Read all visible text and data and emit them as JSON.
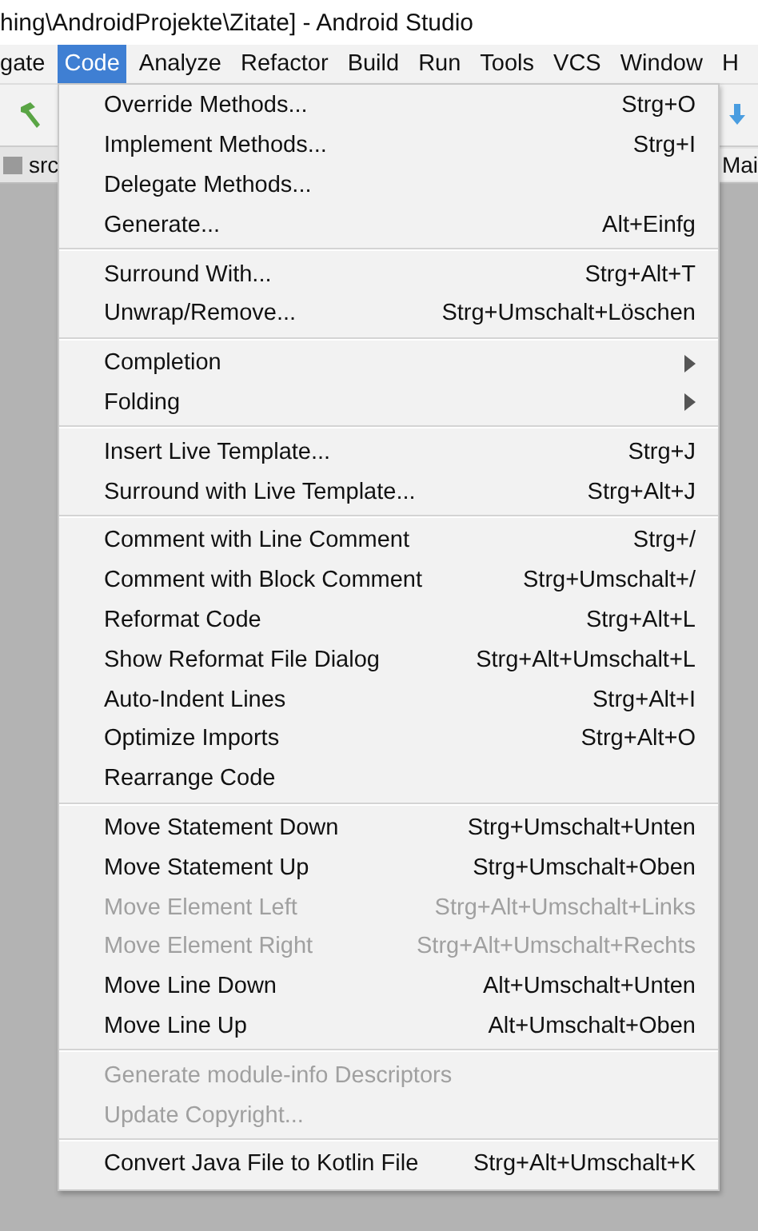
{
  "window": {
    "title": "hing\\AndroidProjekte\\Zitate] - Android Studio"
  },
  "menu_bar": [
    {
      "label": "gate",
      "selected": false
    },
    {
      "label": "Code",
      "selected": true
    },
    {
      "label": "Analyze",
      "selected": false
    },
    {
      "label": "Refactor",
      "selected": false
    },
    {
      "label": "Build",
      "selected": false
    },
    {
      "label": "Run",
      "selected": false
    },
    {
      "label": "Tools",
      "selected": false
    },
    {
      "label": "VCS",
      "selected": false
    },
    {
      "label": "Window",
      "selected": false
    },
    {
      "label": "H",
      "selected": false
    }
  ],
  "navigation_bar": {
    "path": "src",
    "editor_tab": "Mai"
  },
  "menu": {
    "sections": [
      [
        {
          "kind": "item",
          "label": "Override Methods...",
          "shortcut": "Strg+O",
          "disabled": false
        },
        {
          "kind": "item",
          "label": "Implement Methods...",
          "shortcut": "Strg+I",
          "disabled": false
        },
        {
          "kind": "item",
          "label": "Delegate Methods...",
          "disabled": false
        },
        {
          "kind": "item",
          "label": "Generate...",
          "shortcut": "Alt+Einfg",
          "disabled": false
        }
      ],
      [
        {
          "kind": "item",
          "label": "Surround With...",
          "shortcut": "Strg+Alt+T",
          "disabled": false
        },
        {
          "kind": "item",
          "label": "Unwrap/Remove...",
          "shortcut": "Strg+Umschalt+Löschen",
          "disabled": false
        }
      ],
      [
        {
          "kind": "submenu",
          "label": "Completion",
          "disabled": false
        },
        {
          "kind": "submenu",
          "label": "Folding",
          "disabled": false
        }
      ],
      [
        {
          "kind": "item",
          "label": "Insert Live Template...",
          "shortcut": "Strg+J",
          "disabled": false
        },
        {
          "kind": "item",
          "label": "Surround with Live Template...",
          "shortcut": "Strg+Alt+J",
          "disabled": false
        }
      ],
      [
        {
          "kind": "item",
          "label": "Comment with Line Comment",
          "shortcut": "Strg+/",
          "disabled": false
        },
        {
          "kind": "item",
          "label": "Comment with Block Comment",
          "shortcut": "Strg+Umschalt+/",
          "disabled": false
        },
        {
          "kind": "item",
          "label": "Reformat Code",
          "shortcut": "Strg+Alt+L",
          "disabled": false
        },
        {
          "kind": "item",
          "label": "Show Reformat File Dialog",
          "shortcut": "Strg+Alt+Umschalt+L",
          "disabled": false
        },
        {
          "kind": "item",
          "label": "Auto-Indent Lines",
          "shortcut": "Strg+Alt+I",
          "disabled": false
        },
        {
          "kind": "item",
          "label": "Optimize Imports",
          "shortcut": "Strg+Alt+O",
          "disabled": false
        },
        {
          "kind": "item",
          "label": "Rearrange Code",
          "disabled": false
        }
      ],
      [
        {
          "kind": "item",
          "label": "Move Statement Down",
          "shortcut": "Strg+Umschalt+Unten",
          "disabled": false
        },
        {
          "kind": "item",
          "label": "Move Statement Up",
          "shortcut": "Strg+Umschalt+Oben",
          "disabled": false
        },
        {
          "kind": "item",
          "label": "Move Element Left",
          "shortcut": "Strg+Alt+Umschalt+Links",
          "disabled": true
        },
        {
          "kind": "item",
          "label": "Move Element Right",
          "shortcut": "Strg+Alt+Umschalt+Rechts",
          "disabled": true
        },
        {
          "kind": "item",
          "label": "Move Line Down",
          "shortcut": "Alt+Umschalt+Unten",
          "disabled": false
        },
        {
          "kind": "item",
          "label": "Move Line Up",
          "shortcut": "Alt+Umschalt+Oben",
          "disabled": false
        }
      ],
      [
        {
          "kind": "item",
          "label": "Generate module-info Descriptors",
          "disabled": true
        },
        {
          "kind": "item",
          "label": "Update Copyright...",
          "disabled": true
        }
      ],
      [
        {
          "kind": "item",
          "label": "Convert Java File to Kotlin File",
          "shortcut": "Strg+Alt+Umschalt+K",
          "disabled": false
        }
      ]
    ]
  }
}
